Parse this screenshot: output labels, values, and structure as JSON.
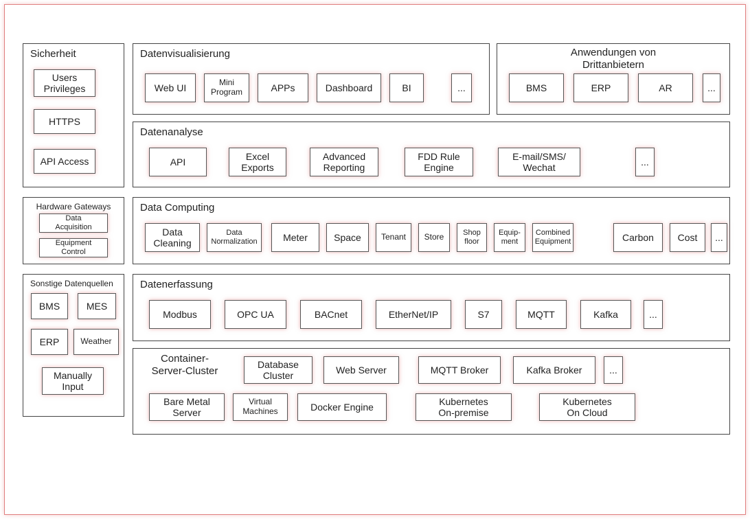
{
  "security": {
    "title": "Sicherheit",
    "boxes": [
      "Users\nPrivileges",
      "HTTPS",
      "API Access"
    ]
  },
  "visualization": {
    "title": "Datenvisualisierung",
    "boxes": [
      "Web UI",
      "Mini\nProgram",
      "APPs",
      "Dashboard",
      "BI",
      "..."
    ]
  },
  "thirdparty": {
    "title": "Anwendungen von\nDrittanbietern",
    "boxes": [
      "BMS",
      "ERP",
      "AR",
      "..."
    ]
  },
  "analysis": {
    "title": "Datenanalyse",
    "boxes": [
      "API",
      "Excel\nExports",
      "Advanced\nReporting",
      "FDD Rule\nEngine",
      "E-mail/SMS/\nWechat",
      "..."
    ]
  },
  "gateways": {
    "title": "Hardware Gateways",
    "boxes": [
      "Data\nAcquisition",
      "Equipment\nControl"
    ]
  },
  "computing": {
    "title": "Data Computing",
    "boxes": [
      "Data\nCleaning",
      "Data\nNormalization",
      "Meter",
      "Space",
      "Tenant",
      "Store",
      "Shop\nfloor",
      "Equip-\nment",
      "Combined\nEquipment",
      "Carbon",
      "Cost",
      "..."
    ]
  },
  "othersources": {
    "title": "Sonstige Datenquellen",
    "boxes": [
      "BMS",
      "MES",
      "ERP",
      "Weather",
      "Manually\nInput"
    ]
  },
  "acquisition": {
    "title": "Datenerfassung",
    "boxes": [
      "Modbus",
      "OPC UA",
      "BACnet",
      "EtherNet/IP",
      "S7",
      "MQTT",
      "Kafka",
      "..."
    ]
  },
  "cluster": {
    "title": "Container-\nServer-Cluster",
    "row1": [
      "Database\nCluster",
      "Web Server",
      "MQTT Broker",
      "Kafka  Broker",
      "..."
    ],
    "row2": [
      "Bare Metal\nServer",
      "Virtual\nMachines",
      "Docker Engine",
      "Kubernetes\nOn-premise",
      "Kubernetes\nOn Cloud"
    ]
  }
}
